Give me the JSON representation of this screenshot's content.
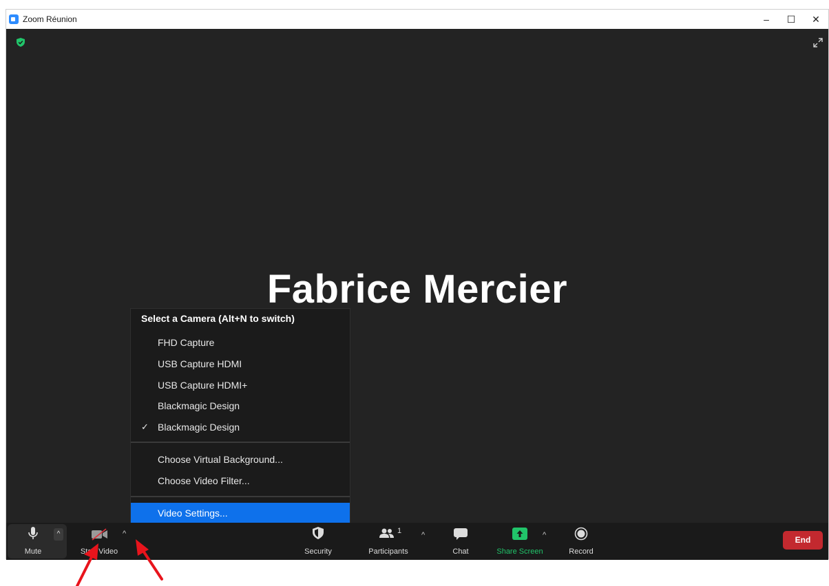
{
  "window": {
    "title": "Zoom Réunion",
    "controls": {
      "minimize": "–",
      "maximize": "☐",
      "close": "✕"
    }
  },
  "stage": {
    "participant_name": "Fabrice Mercier",
    "icons": [
      "shield-check-icon",
      "expand-icon"
    ]
  },
  "camera_menu": {
    "header": "Select a Camera (Alt+N to switch)",
    "cameras": [
      {
        "label": "FHD Capture",
        "checked": false
      },
      {
        "label": "USB Capture HDMI",
        "checked": false
      },
      {
        "label": "USB Capture HDMI+",
        "checked": false
      },
      {
        "label": "Blackmagic Design",
        "checked": false
      },
      {
        "label": "Blackmagic Design",
        "checked": true
      }
    ],
    "check_glyph": "✓",
    "options": [
      {
        "label": "Choose Virtual Background..."
      },
      {
        "label": "Choose Video Filter..."
      }
    ],
    "settings": {
      "label": "Video Settings...",
      "highlighted": true
    }
  },
  "toolbar": {
    "mute": "Mute",
    "start_video": "Start Video",
    "security": "Security",
    "participants": "Participants",
    "participants_count": "1",
    "chat": "Chat",
    "share_screen": "Share Screen",
    "record": "Record",
    "end": "End",
    "caret": "^"
  },
  "colors": {
    "accent": "#0e71eb",
    "share_green": "#21c46a",
    "end_red": "#c3292f",
    "annotation_red": "#e8141c",
    "stage_bg": "#232323"
  }
}
